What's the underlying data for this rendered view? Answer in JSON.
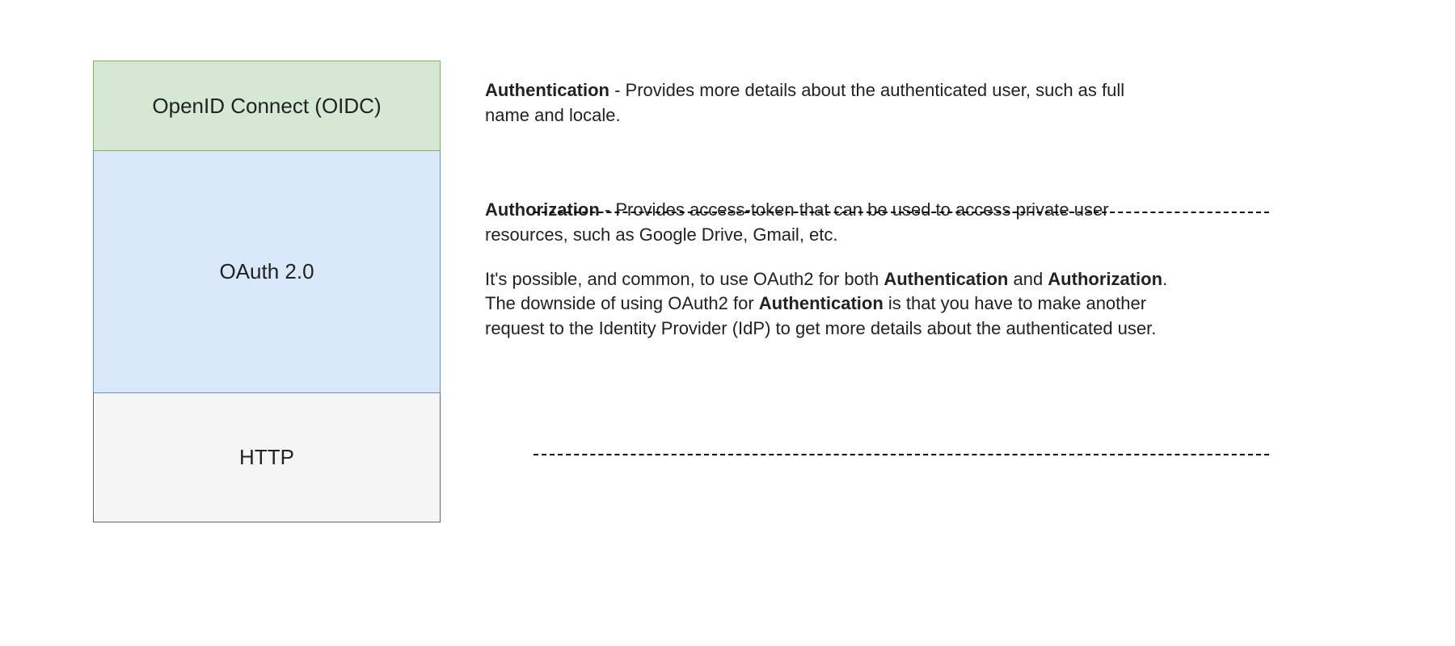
{
  "layers": {
    "oidc": {
      "title": "OpenID Connect (OIDC)",
      "desc_bold": "Authentication",
      "desc_rest": " - Provides more details about the authenticated user, such as full name and locale."
    },
    "oauth": {
      "title": "OAuth 2.0",
      "p1_bold": "Authorization",
      "p1_rest": " - Provides access-token that can be used to access private user resources, such as Google Drive, Gmail, etc.",
      "p2_a": "It's possible, and common, to use OAuth2 for both ",
      "p2_b1": "Authentication",
      "p2_c": " and ",
      "p2_b2": "Authorization",
      "p2_d": ". The downside of using OAuth2 for ",
      "p2_b3": "Authentication",
      "p2_e": " is that you have to make another request to the Identity Provider (IdP) to get more details about the authenticated user."
    },
    "http": {
      "title": "HTTP"
    }
  }
}
